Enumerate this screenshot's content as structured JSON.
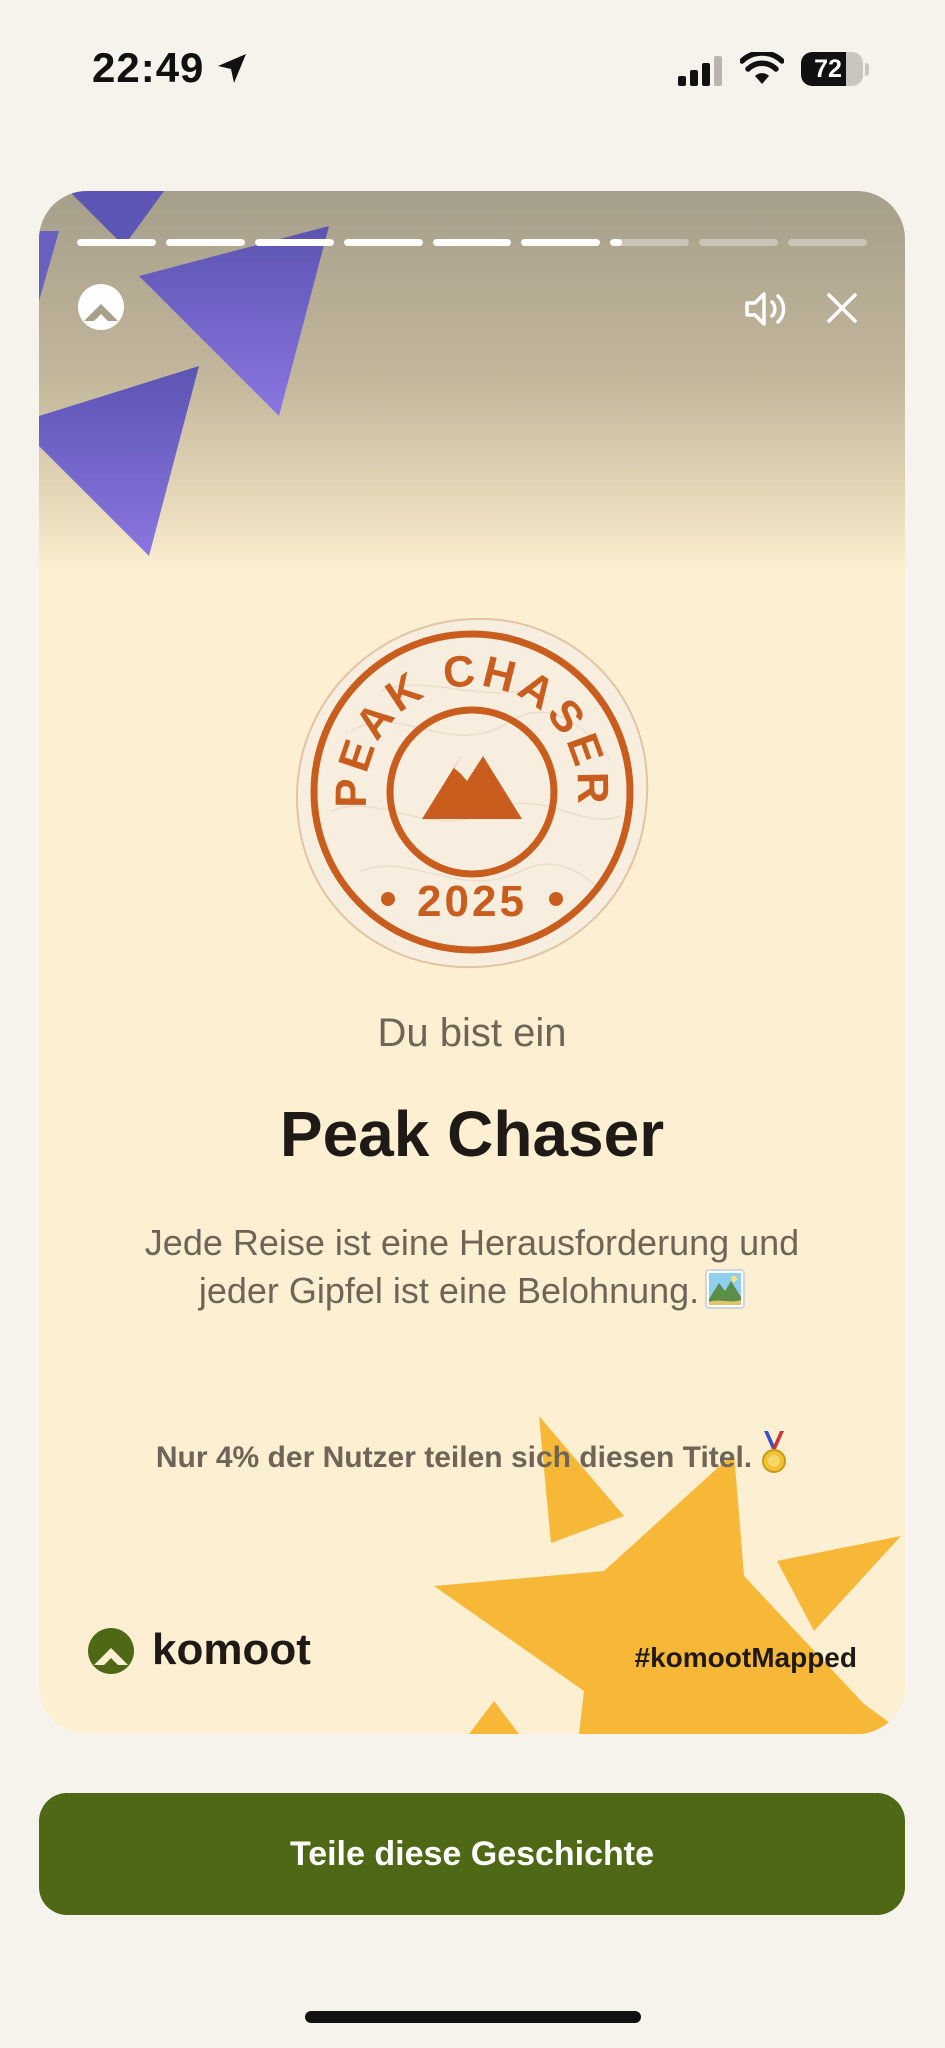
{
  "status_bar": {
    "time": "22:49",
    "battery": "72",
    "battery_level": 0.72
  },
  "story": {
    "progress": {
      "segments": 9,
      "completed": 6,
      "current_fraction": 0.15
    },
    "badge": {
      "title": "PEAK CHASER",
      "year": "2025"
    },
    "subtitle": "Du bist ein",
    "title": "Peak Chaser",
    "description": "Jede Reise ist eine Herausforderung und jeder Gipfel ist eine Belohnung.",
    "stat": "Nur 4% der Nutzer teilen sich diesen Titel.",
    "brand": "komoot",
    "hashtag": "#komootMapped",
    "icons": {
      "close": "close-icon",
      "volume": "volume-icon",
      "logo": "komoot-logo-icon",
      "emoji": "landscape-picture-icon",
      "medal": "medal-icon"
    },
    "colors": {
      "accent_orange": "#c85d1e",
      "decor_purple": "#6e62c4",
      "decor_yellow": "#f8b837",
      "brand_green": "#4e6816"
    }
  },
  "share_button": {
    "label": "Teile diese Geschichte"
  }
}
